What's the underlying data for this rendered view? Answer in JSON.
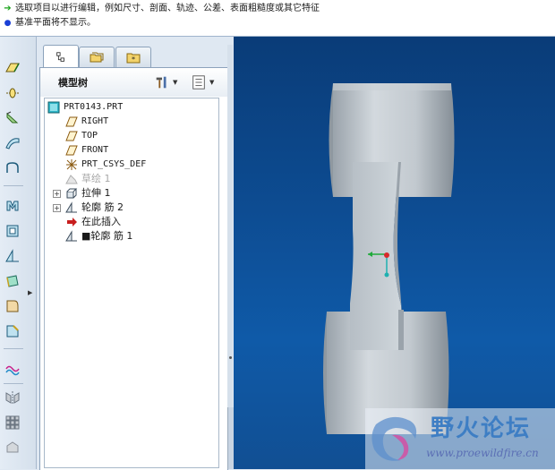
{
  "message_area": {
    "line1": "选取项目以进行编辑，例如尺寸、剖面、轨迹、公差、表面粗糙度或其它特征",
    "line2": "基准平面将不显示。"
  },
  "toolbar": {
    "icons": [
      "datum-plane-icon",
      "datum-axis-icon",
      "datum-curve-icon",
      "datum-point-icon",
      "sketch-tool-icon",
      "coordinate-system-icon",
      "hole-icon",
      "shell-icon",
      "rib-icon",
      "draft-icon",
      "round-icon",
      "chamfer-icon",
      "style-icon",
      "mirror-icon",
      "pattern-icon",
      "merge-icon"
    ]
  },
  "navigator": {
    "tabs": [
      "model-tree-tab",
      "folder-browser-tab",
      "favorites-tab"
    ],
    "title": "模型树"
  },
  "tree": {
    "items": [
      {
        "label": "PRT0143.PRT",
        "icon": "part-icon"
      },
      {
        "label": "RIGHT",
        "icon": "datum-plane-icon"
      },
      {
        "label": "TOP",
        "icon": "datum-plane-icon"
      },
      {
        "label": "FRONT",
        "icon": "datum-plane-icon"
      },
      {
        "label": "PRT_CSYS_DEF",
        "icon": "coordinate-system-icon"
      },
      {
        "label": "草绘 1",
        "icon": "sketch-icon",
        "state": "suppressed"
      },
      {
        "label": "拉伸 1",
        "icon": "extrude-icon",
        "expandable": true
      },
      {
        "label": "轮廓 筋 2",
        "icon": "rib-icon",
        "expandable": true
      },
      {
        "label": "在此插入",
        "icon": "insert-here-icon"
      },
      {
        "label": "■轮廓 筋 1",
        "icon": "rib-icon"
      }
    ]
  },
  "watermark": {
    "title": "野火论坛",
    "url": "www.proewildfire.cn"
  },
  "colors": {
    "viewport_top": "#0a3c78",
    "viewport_bottom": "#114f93",
    "model_gray": "#c4ccd2",
    "insert_arrow": "#c81e1e"
  }
}
